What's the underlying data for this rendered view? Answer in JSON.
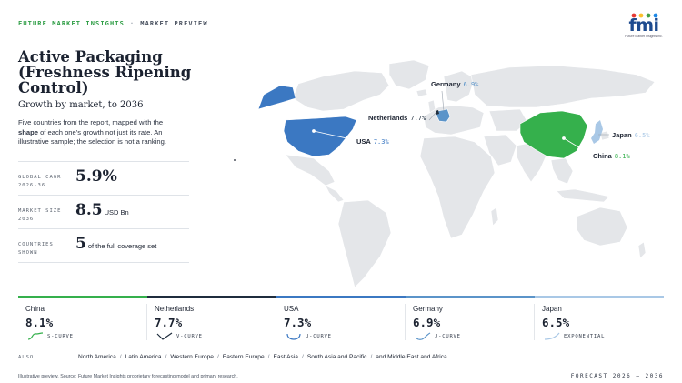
{
  "header": {
    "brand": "FUTURE MARKET INSIGHTS",
    "separator": "·",
    "section": "MARKET PREVIEW"
  },
  "logo": {
    "letters": "fmi",
    "tagline": "Future Market Insights Inc.",
    "dot_colors": [
      "#e53935",
      "#fbc02d",
      "#43a047",
      "#1e88e5"
    ]
  },
  "title": "Active Packaging (Freshness Ripening Control)",
  "subtitle": "Growth by market, to 2036",
  "description": {
    "before": "Five countries from the report, mapped with the ",
    "emphasis": "shape",
    "after": " of each one's growth not just its rate. An illustrative sample; the selection is not a ranking."
  },
  "stats": [
    {
      "label": "GLOBAL CAGR 2026-36",
      "value": "5.9%",
      "unit": ""
    },
    {
      "label": "MARKET SIZE 2036",
      "value": "8.5",
      "unit": "USD Bn"
    },
    {
      "label": "COUNTRIES SHOWN",
      "value": "5",
      "unit": "of the full coverage set"
    }
  ],
  "map_labels": [
    {
      "country": "Germany",
      "pct": "6.9%"
    },
    {
      "country": "Netherlands",
      "pct": "7.7%"
    },
    {
      "country": "USA",
      "pct": "7.3%"
    },
    {
      "country": "Japan",
      "pct": "6.5%"
    },
    {
      "country": "China",
      "pct": "8.1%"
    }
  ],
  "colors": {
    "china": "#35b04c",
    "netherlands": "#1f2d3d",
    "usa": "#3b78c2",
    "germany": "#5b94c9",
    "japan": "#a9c8e6",
    "land": "#e4e6e9",
    "accent_green": "#2f9e46"
  },
  "cards": [
    {
      "country": "China",
      "value": "8.1%",
      "curve": "S-CURVE",
      "icon": "s-curve-icon",
      "color": "#35b04c"
    },
    {
      "country": "Netherlands",
      "value": "7.7%",
      "curve": "V-CURVE",
      "icon": "v-curve-icon",
      "color": "#1f2d3d"
    },
    {
      "country": "USA",
      "value": "7.3%",
      "curve": "U-CURVE",
      "icon": "u-curve-icon",
      "color": "#3b78c2"
    },
    {
      "country": "Germany",
      "value": "6.9%",
      "curve": "J-CURVE",
      "icon": "j-curve-icon",
      "color": "#5b94c9"
    },
    {
      "country": "Japan",
      "value": "6.5%",
      "curve": "EXPONENTIAL",
      "icon": "exponential-curve-icon",
      "color": "#a9c8e6"
    }
  ],
  "also": {
    "label": "ALSO",
    "regions": [
      "North America",
      "Latin America",
      "Western Europe",
      "Eastern Europe",
      "East Asia",
      "South Asia and Pacific",
      "and Middle East and Africa."
    ]
  },
  "footer": {
    "note": "Illustrative preview. Source: Future Market Insights proprietary forecasting model and primary research.",
    "forecast": "FORECAST 2026 – 2036"
  }
}
